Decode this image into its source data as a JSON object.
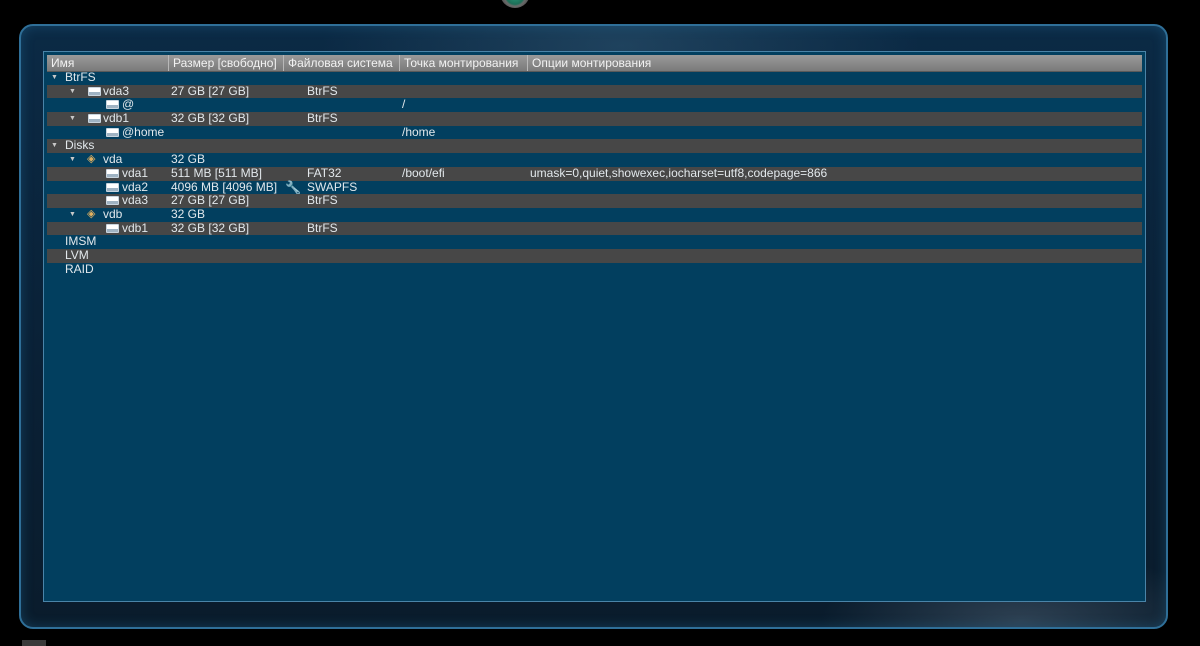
{
  "colors": {
    "panel_bg": "#023f5f",
    "alt_row": "#474747",
    "header_bg": "#8a8a8a",
    "frame_border": "#2f6f98",
    "text": "#e2e8ec"
  },
  "columns": [
    {
      "label": "Имя"
    },
    {
      "label": "Размер [свободно]"
    },
    {
      "label": "Файловая система"
    },
    {
      "label": "Точка монтирования"
    },
    {
      "label": "Опции монтирования"
    }
  ],
  "rows": [
    {
      "name": "BtrFS",
      "level": 0,
      "expander": true,
      "icon": "",
      "size": "",
      "fs": "",
      "mount": "",
      "options": ""
    },
    {
      "name": "vda3",
      "level": 1,
      "expander": true,
      "icon": "device-icon",
      "size": "27 GB [27 GB]",
      "fs": "BtrFS",
      "mount": "",
      "options": ""
    },
    {
      "name": "@",
      "level": 2,
      "expander": false,
      "icon": "device-icon",
      "size": "",
      "fs": "",
      "mount": "/",
      "options": ""
    },
    {
      "name": "vdb1",
      "level": 1,
      "expander": true,
      "icon": "device-icon",
      "size": "32 GB [32 GB]",
      "fs": "BtrFS",
      "mount": "",
      "options": ""
    },
    {
      "name": "@home",
      "level": 2,
      "expander": false,
      "icon": "device-icon",
      "size": "",
      "fs": "",
      "mount": "/home",
      "options": ""
    },
    {
      "name": "Disks",
      "level": 0,
      "expander": true,
      "icon": "",
      "size": "",
      "fs": "",
      "mount": "",
      "options": ""
    },
    {
      "name": "vda",
      "level": 1,
      "expander": true,
      "icon": "disk-icon",
      "size": "32 GB",
      "fs": "",
      "mount": "",
      "options": ""
    },
    {
      "name": "vda1",
      "level": 2,
      "expander": false,
      "icon": "device-icon",
      "size": "511 MB [511 MB]",
      "fs": "FAT32",
      "mount": "/boot/efi",
      "options": "umask=0,quiet,showexec,iocharset=utf8,codepage=866"
    },
    {
      "name": "vda2",
      "level": 2,
      "expander": false,
      "icon": "device-icon",
      "size": "4096 MB [4096 MB]",
      "fs": "SWAPFS",
      "fs_icon": "wrench-icon",
      "mount": "",
      "options": ""
    },
    {
      "name": "vda3",
      "level": 2,
      "expander": false,
      "icon": "device-icon",
      "size": "27 GB [27 GB]",
      "fs": "BtrFS",
      "mount": "",
      "options": ""
    },
    {
      "name": "vdb",
      "level": 1,
      "expander": true,
      "icon": "disk-icon",
      "size": "32 GB",
      "fs": "",
      "mount": "",
      "options": ""
    },
    {
      "name": "vdb1",
      "level": 2,
      "expander": false,
      "icon": "device-icon",
      "size": "32 GB [32 GB]",
      "fs": "BtrFS",
      "mount": "",
      "options": ""
    },
    {
      "name": "IMSM",
      "level": 0,
      "expander": false,
      "icon": "",
      "size": "",
      "fs": "",
      "mount": "",
      "options": ""
    },
    {
      "name": "LVM",
      "level": 0,
      "expander": false,
      "icon": "",
      "size": "",
      "fs": "",
      "mount": "",
      "options": ""
    },
    {
      "name": "RAID",
      "level": 0,
      "expander": false,
      "icon": "",
      "size": "",
      "fs": "",
      "mount": "",
      "options": ""
    }
  ]
}
